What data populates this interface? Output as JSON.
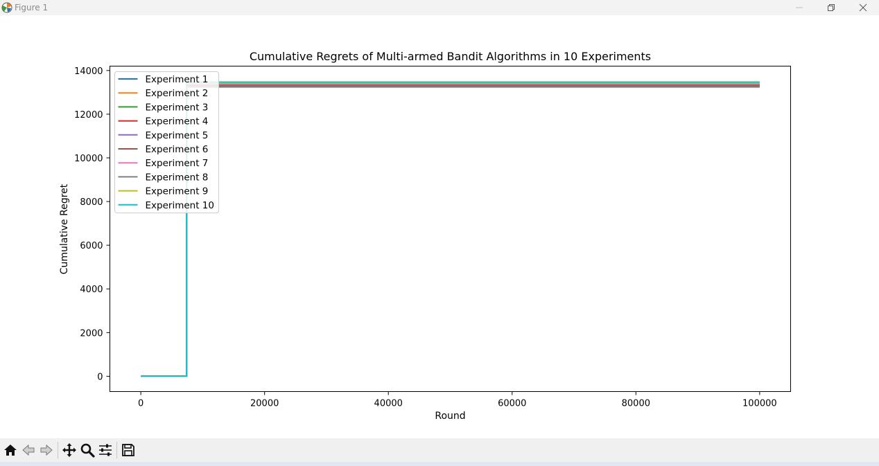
{
  "window": {
    "title": "Figure 1",
    "icons": {
      "app": "matplotlib-icon",
      "minimize": "minimize-icon",
      "maximize": "restore-icon",
      "close": "close-icon"
    }
  },
  "toolbar": {
    "buttons": [
      {
        "name": "home-icon"
      },
      {
        "name": "back-icon"
      },
      {
        "name": "forward-icon"
      },
      {
        "name": "pan-icon"
      },
      {
        "name": "zoom-icon"
      },
      {
        "name": "configure-subplots-icon"
      },
      {
        "name": "save-icon"
      }
    ]
  },
  "chart_data": {
    "type": "line",
    "title": "Cumulative Regrets of Multi-armed Bandit Algorithms in 10 Experiments",
    "xlabel": "Round",
    "ylabel": "Cumulative Regret",
    "xlim": [
      -5000,
      105000
    ],
    "ylim": [
      -700,
      14200
    ],
    "xticks": [
      0,
      20000,
      40000,
      60000,
      80000,
      100000
    ],
    "xtick_labels": [
      "0",
      "20000",
      "40000",
      "60000",
      "80000",
      "100000"
    ],
    "yticks": [
      0,
      2000,
      4000,
      6000,
      8000,
      10000,
      12000,
      14000
    ],
    "ytick_labels": [
      "0",
      "2000",
      "4000",
      "6000",
      "8000",
      "10000",
      "12000",
      "14000"
    ],
    "legend_position": "upper-left",
    "grid": false,
    "series": [
      {
        "name": "Experiment 1",
        "color": "#1f77b4",
        "x": [
          0,
          7400,
          7400,
          100000
        ],
        "y": [
          0,
          0,
          13380,
          13380
        ]
      },
      {
        "name": "Experiment 2",
        "color": "#ff7f0e",
        "x": [
          0,
          7400,
          7400,
          100000
        ],
        "y": [
          0,
          0,
          13300,
          13300
        ]
      },
      {
        "name": "Experiment 3",
        "color": "#2ca02c",
        "x": [
          0,
          7400,
          7400,
          100000
        ],
        "y": [
          0,
          0,
          13350,
          13350
        ]
      },
      {
        "name": "Experiment 4",
        "color": "#d62728",
        "x": [
          0,
          7400,
          7400,
          100000
        ],
        "y": [
          0,
          0,
          13320,
          13320
        ]
      },
      {
        "name": "Experiment 5",
        "color": "#9467bd",
        "x": [
          0,
          7400,
          7400,
          100000
        ],
        "y": [
          0,
          0,
          13360,
          13360
        ]
      },
      {
        "name": "Experiment 6",
        "color": "#8c564b",
        "x": [
          0,
          7400,
          7400,
          100000
        ],
        "y": [
          0,
          0,
          13250,
          13250
        ]
      },
      {
        "name": "Experiment 7",
        "color": "#e377c2",
        "x": [
          0,
          7400,
          7400,
          100000
        ],
        "y": [
          0,
          0,
          13400,
          13400
        ]
      },
      {
        "name": "Experiment 8",
        "color": "#7f7f7f",
        "x": [
          0,
          7400,
          7400,
          100000
        ],
        "y": [
          0,
          0,
          13280,
          13280
        ]
      },
      {
        "name": "Experiment 9",
        "color": "#bcbd22",
        "x": [
          0,
          7400,
          7400,
          100000
        ],
        "y": [
          0,
          0,
          13420,
          13420
        ]
      },
      {
        "name": "Experiment 10",
        "color": "#17becf",
        "x": [
          0,
          7400,
          7400,
          100000
        ],
        "y": [
          0,
          0,
          13470,
          13470
        ]
      }
    ]
  }
}
